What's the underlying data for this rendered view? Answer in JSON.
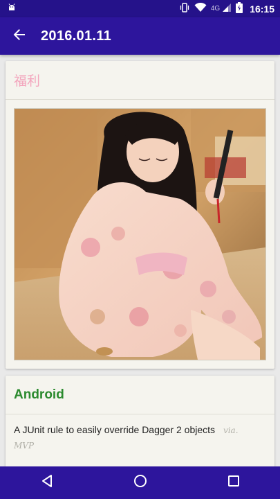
{
  "status_bar": {
    "network_label": "4G",
    "time": "16:15",
    "icons": [
      "android-debug-icon",
      "vibrate-icon",
      "wifi-icon",
      "signal-icon",
      "battery-icon"
    ]
  },
  "app_bar": {
    "title": "2016.01.11",
    "back_icon": "arrow-left-icon"
  },
  "cards": [
    {
      "category": "福利",
      "category_color": "#f3a6bd",
      "image_description_icon": "photo"
    },
    {
      "category": "Android",
      "category_color": "#2b8a2e",
      "items": [
        {
          "title": "A JUnit rule to easily override Dagger 2 objects",
          "via_label": "via.",
          "author": "MVP"
        }
      ]
    }
  ],
  "nav_bar": {
    "icons": [
      "back-triangle-icon",
      "home-circle-icon",
      "recents-square-icon"
    ]
  },
  "colors": {
    "primary": "#2d159c",
    "primary_dark": "#25128a",
    "card_bg": "#f5f4ee"
  }
}
